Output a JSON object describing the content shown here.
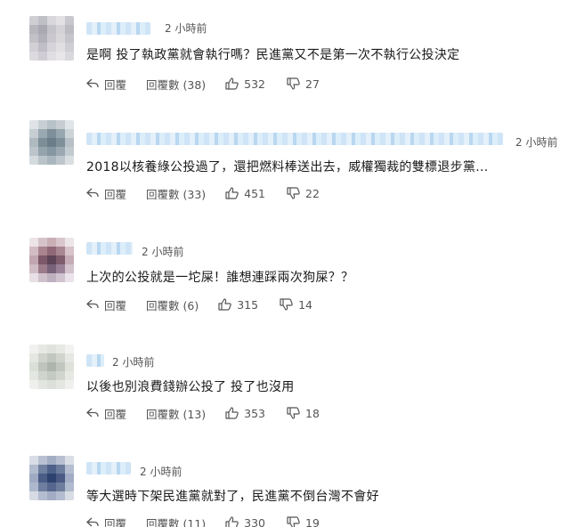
{
  "comments": [
    {
      "time": "2 小時前",
      "text": "是啊 投了執政黨就會執行嗎？民進黨又不是第一次不執行公投決定",
      "reply_label": "回覆",
      "replies_label": "回覆數 (38)",
      "likes": "532",
      "dislikes": "27"
    },
    {
      "time": "2 小時前",
      "text": "2018以核養綠公投過了，還把燃料棒送出去，威權獨裁的雙標退步黨...",
      "reply_label": "回覆",
      "replies_label": "回覆數 (33)",
      "likes": "451",
      "dislikes": "22"
    },
    {
      "time": "2 小時前",
      "text": "上次的公投就是一坨屎！誰想連踩兩次狗屎？？",
      "reply_label": "回覆",
      "replies_label": "回覆數 (6)",
      "likes": "315",
      "dislikes": "14"
    },
    {
      "time": "2 小時前",
      "text": "以後也別浪費錢辦公投了 投了也沒用",
      "reply_label": "回覆",
      "replies_label": "回覆數 (13)",
      "likes": "353",
      "dislikes": "18"
    },
    {
      "time": "2 小時前",
      "text": "等大選時下架民進黨就對了，民進黨不倒台灣不會好",
      "reply_label": "回覆",
      "replies_label": "回覆數 (11)",
      "likes": "330",
      "dislikes": "19"
    }
  ],
  "icons": {
    "reply": "reply-arrow-icon",
    "like": "thumbs-up-icon",
    "dislike": "thumbs-down-icon"
  },
  "colors": {
    "text": "#1a1a1a",
    "meta": "#555555",
    "blur_name": "#cfe4f6"
  }
}
